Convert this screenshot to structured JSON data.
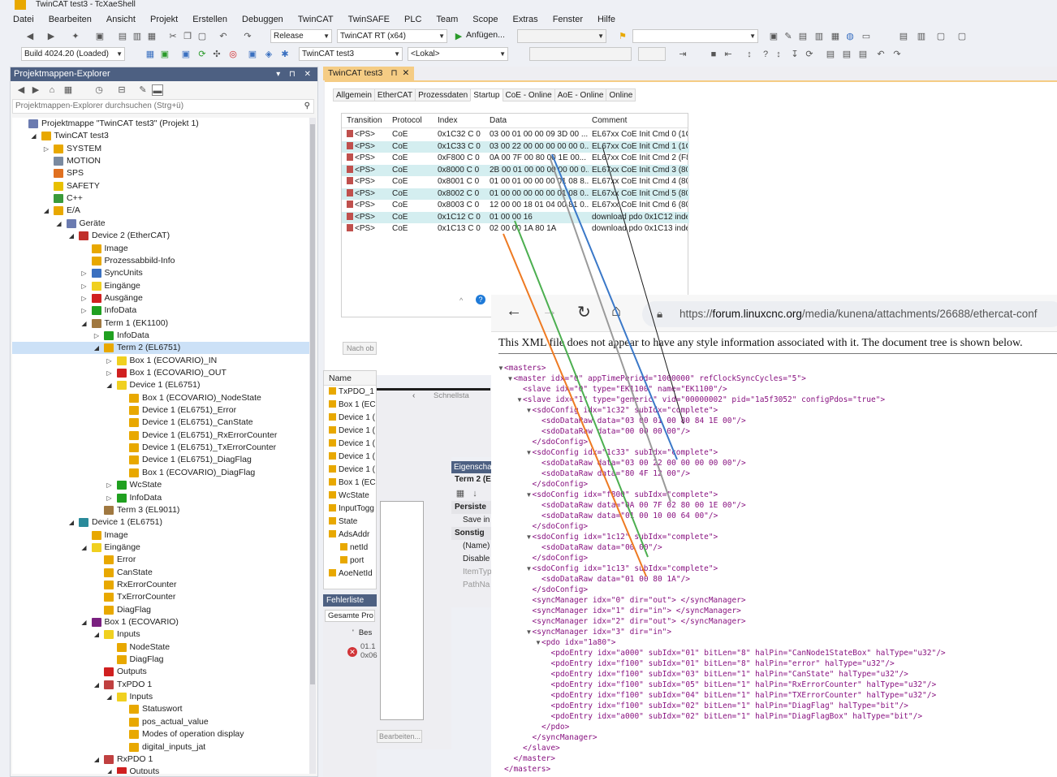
{
  "window": {
    "title": "TwinCAT test3 - TcXaeShell"
  },
  "menu": [
    "Datei",
    "Bearbeiten",
    "Ansicht",
    "Projekt",
    "Erstellen",
    "Debuggen",
    "TwinCAT",
    "TwinSAFE",
    "PLC",
    "Team",
    "Scope",
    "Extras",
    "Fenster",
    "Hilfe"
  ],
  "toolbar": {
    "config": "Release",
    "platform": "TwinCAT RT (x64)",
    "attach": "Anfügen...",
    "build": "Build 4024.20 (Loaded)",
    "project": "TwinCAT test3",
    "target": "<Lokal>"
  },
  "explorer": {
    "title": "Projektmappen-Explorer",
    "search_placeholder": "Projektmappen-Explorer durchsuchen (Strg+ü)",
    "items": [
      {
        "label": "Projektmappe \"TwinCAT test3\" (Projekt 1)",
        "lvl": 0,
        "exp": "",
        "color": "#6b7bb0"
      },
      {
        "label": "TwinCAT test3",
        "lvl": 1,
        "exp": "◢",
        "color": "#e8a800"
      },
      {
        "label": "SYSTEM",
        "lvl": 2,
        "exp": "▷",
        "color": "#e8a800"
      },
      {
        "label": "MOTION",
        "lvl": 2,
        "exp": "",
        "color": "#7a8aa0"
      },
      {
        "label": "SPS",
        "lvl": 2,
        "exp": "",
        "color": "#e07020"
      },
      {
        "label": "SAFETY",
        "lvl": 2,
        "exp": "",
        "color": "#e8c000"
      },
      {
        "label": "C++",
        "lvl": 2,
        "exp": "",
        "color": "#3a9a3a"
      },
      {
        "label": "E/A",
        "lvl": 2,
        "exp": "◢",
        "color": "#e8a800"
      },
      {
        "label": "Geräte",
        "lvl": 3,
        "exp": "◢",
        "color": "#6b7bb0"
      },
      {
        "label": "Device 2 (EtherCAT)",
        "lvl": 4,
        "exp": "◢",
        "color": "#c0302a"
      },
      {
        "label": "Image",
        "lvl": 5,
        "exp": "",
        "color": "#e8a800"
      },
      {
        "label": "Prozessabbild-Info",
        "lvl": 5,
        "exp": "",
        "color": "#e8a800"
      },
      {
        "label": "SyncUnits",
        "lvl": 5,
        "exp": "▷",
        "color": "#3a70c0"
      },
      {
        "label": "Eingänge",
        "lvl": 5,
        "exp": "▷",
        "color": "#f0d020"
      },
      {
        "label": "Ausgänge",
        "lvl": 5,
        "exp": "▷",
        "color": "#d02020"
      },
      {
        "label": "InfoData",
        "lvl": 5,
        "exp": "▷",
        "color": "#20a020"
      },
      {
        "label": "Term 1 (EK1100)",
        "lvl": 5,
        "exp": "◢",
        "color": "#a07840"
      },
      {
        "label": "InfoData",
        "lvl": 6,
        "exp": "▷",
        "color": "#20a020"
      },
      {
        "label": "Term 2 (EL6751)",
        "lvl": 6,
        "exp": "◢",
        "color": "#e8a800",
        "sel": true
      },
      {
        "label": "Box 1 (ECOVARIO)_IN",
        "lvl": 7,
        "exp": "▷",
        "color": "#f0d020"
      },
      {
        "label": "Box 1 (ECOVARIO)_OUT",
        "lvl": 7,
        "exp": "▷",
        "color": "#d02020"
      },
      {
        "label": "Device 1 (EL6751)",
        "lvl": 7,
        "exp": "◢",
        "color": "#f0d020"
      },
      {
        "label": "Box 1 (ECOVARIO)_NodeState",
        "lvl": 8,
        "exp": "",
        "color": "#e8a800"
      },
      {
        "label": "Device 1 (EL6751)_Error",
        "lvl": 8,
        "exp": "",
        "color": "#e8a800"
      },
      {
        "label": "Device 1 (EL6751)_CanState",
        "lvl": 8,
        "exp": "",
        "color": "#e8a800"
      },
      {
        "label": "Device 1 (EL6751)_RxErrorCounter",
        "lvl": 8,
        "exp": "",
        "color": "#e8a800"
      },
      {
        "label": "Device 1 (EL6751)_TxErrorCounter",
        "lvl": 8,
        "exp": "",
        "color": "#e8a800"
      },
      {
        "label": "Device 1 (EL6751)_DiagFlag",
        "lvl": 8,
        "exp": "",
        "color": "#e8a800"
      },
      {
        "label": "Box 1 (ECOVARIO)_DiagFlag",
        "lvl": 8,
        "exp": "",
        "color": "#e8a800"
      },
      {
        "label": "WcState",
        "lvl": 7,
        "exp": "▷",
        "color": "#20a020"
      },
      {
        "label": "InfoData",
        "lvl": 7,
        "exp": "▷",
        "color": "#20a020"
      },
      {
        "label": "Term 3 (EL9011)",
        "lvl": 6,
        "exp": "",
        "color": "#a07840"
      },
      {
        "label": "Device 1 (EL6751)",
        "lvl": 4,
        "exp": "◢",
        "color": "#2a8a9a"
      },
      {
        "label": "Image",
        "lvl": 5,
        "exp": "",
        "color": "#e8a800"
      },
      {
        "label": "Eingänge",
        "lvl": 5,
        "exp": "◢",
        "color": "#f0d020"
      },
      {
        "label": "Error",
        "lvl": 6,
        "exp": "",
        "color": "#e8a800"
      },
      {
        "label": "CanState",
        "lvl": 6,
        "exp": "",
        "color": "#e8a800"
      },
      {
        "label": "RxErrorCounter",
        "lvl": 6,
        "exp": "",
        "color": "#e8a800"
      },
      {
        "label": "TxErrorCounter",
        "lvl": 6,
        "exp": "",
        "color": "#e8a800"
      },
      {
        "label": "DiagFlag",
        "lvl": 6,
        "exp": "",
        "color": "#e8a800"
      },
      {
        "label": "Box 1 (ECOVARIO)",
        "lvl": 5,
        "exp": "◢",
        "color": "#7a2080"
      },
      {
        "label": "Inputs",
        "lvl": 6,
        "exp": "◢",
        "color": "#f0d020"
      },
      {
        "label": "NodeState",
        "lvl": 7,
        "exp": "",
        "color": "#e8a800"
      },
      {
        "label": "DiagFlag",
        "lvl": 7,
        "exp": "",
        "color": "#e8a800"
      },
      {
        "label": "Outputs",
        "lvl": 6,
        "exp": "",
        "color": "#d02020"
      },
      {
        "label": "TxPDO 1",
        "lvl": 6,
        "exp": "◢",
        "color": "#c04040"
      },
      {
        "label": "Inputs",
        "lvl": 7,
        "exp": "◢",
        "color": "#f0d020"
      },
      {
        "label": "Statuswort",
        "lvl": 8,
        "exp": "",
        "color": "#e8a800"
      },
      {
        "label": "pos_actual_value",
        "lvl": 8,
        "exp": "",
        "color": "#e8a800"
      },
      {
        "label": "Modes of operation display",
        "lvl": 8,
        "exp": "",
        "color": "#e8a800"
      },
      {
        "label": "digital_inputs_jat",
        "lvl": 8,
        "exp": "",
        "color": "#e8a800"
      },
      {
        "label": "RxPDO 1",
        "lvl": 6,
        "exp": "◢",
        "color": "#c04040"
      },
      {
        "label": "Outputs",
        "lvl": 7,
        "exp": "◢",
        "color": "#d02020"
      }
    ]
  },
  "editor": {
    "tab": "TwinCAT test3",
    "subtabs": [
      "Allgemein",
      "EtherCAT",
      "Prozessdaten",
      "Startup",
      "CoE - Online",
      "AoE - Online",
      "Online"
    ],
    "active_subtab": "Startup",
    "columns": [
      "Transition",
      "Protocol",
      "Index",
      "Data",
      "Comment"
    ],
    "rows": [
      {
        "transition": "<PS>",
        "protocol": "CoE",
        "index": "0x1C32 C 0",
        "data": "03 00 01 00 00 09 3D 00 ...",
        "comment": "EL67xx CoE Init Cmd 0 (1C..."
      },
      {
        "transition": "<PS>",
        "protocol": "CoE",
        "index": "0x1C33 C 0",
        "data": "03 00 22 00 00 00 00 00 0...",
        "comment": "EL67xx CoE Init Cmd 1 (1C..."
      },
      {
        "transition": "<PS>",
        "protocol": "CoE",
        "index": "0xF800 C 0",
        "data": "0A 00 7F 00 80 00 1E 00...",
        "comment": "EL67xx CoE Init Cmd 2 (F8..."
      },
      {
        "transition": "<PS>",
        "protocol": "CoE",
        "index": "0x8000 C 0",
        "data": "2B 00 01 00 00 00 00 00 0...",
        "comment": "EL67xx CoE Init Cmd 3 (80..."
      },
      {
        "transition": "<PS>",
        "protocol": "CoE",
        "index": "0x8001 C 0",
        "data": "01 00 01 00 00 00 01 08 8...",
        "comment": "EL67xx CoE Init Cmd 4 (80..."
      },
      {
        "transition": "<PS>",
        "protocol": "CoE",
        "index": "0x8002 C 0",
        "data": "01 00 00 00 00 00 01 08 0...",
        "comment": "EL67xx CoE Init Cmd 5 (80..."
      },
      {
        "transition": "<PS>",
        "protocol": "CoE",
        "index": "0x8003 C 0",
        "data": "12 00 00 18 01 04 00 81 0...",
        "comment": "EL67xx CoE Init Cmd 6 (80..."
      },
      {
        "transition": "<PS>",
        "protocol": "CoE",
        "index": "0x1C12 C 0",
        "data": "01 00 00 16",
        "comment": "download pdo 0x1C12 index"
      },
      {
        "transition": "<PS>",
        "protocol": "CoE",
        "index": "0x1C13 C 0",
        "data": "02 00 00 1A 80 1A",
        "comment": "download pdo 0x1C13 index"
      }
    ],
    "button_nach": "Nach ob"
  },
  "name_panel": {
    "header": "Name",
    "items": [
      "TxPDO_1",
      "Box 1 (EC",
      "Device 1 (",
      "Device 1 (",
      "Device 1 (",
      "Device 1 (",
      "Device 1 (",
      "Box 1 (EC",
      "WcState",
      "InputTogg",
      "State",
      "AdsAddr",
      "netId",
      "port",
      "AoeNetId"
    ]
  },
  "quicksearch": "Schnellsta",
  "properties": {
    "title": "Eigenscha",
    "object": "Term 2 (E",
    "categories": [
      "Persiste",
      "Save in",
      "Sonstig",
      "(Name)",
      "Disable",
      "ItemTyp",
      "PathNa"
    ],
    "button": "Bearbeiten..."
  },
  "errorlist": {
    "title": "Fehlerliste",
    "scope": "Gesamte Pro",
    "col": "Bes",
    "entry_line1": "01.1",
    "entry_line2": "0x06"
  },
  "browser": {
    "url_domain": "forum.linuxcnc.org",
    "url_path": "/media/kunena/attachments/26688/ethercat-conf",
    "url_prefix": "https://",
    "note": "This XML file does not appear to have any style information associated with it. The document tree is shown below.",
    "xml_lines": [
      {
        "i": 0,
        "tri": true,
        "t": "<masters>"
      },
      {
        "i": 1,
        "tri": true,
        "t": "<master idx=\"0\" appTimePeriod=\"1000000\" refClockSyncCycles=\"5\">"
      },
      {
        "i": 2,
        "tri": false,
        "t": "<slave idx=\"0\" type=\"EK1100\" name=\"EK1100\"/>"
      },
      {
        "i": 2,
        "tri": true,
        "t": "<slave idx=\"1\" type=\"generic\" vid=\"00000002\" pid=\"1a5f3052\" configPdos=\"true\">"
      },
      {
        "i": 3,
        "tri": true,
        "t": "<sdoConfig idx=\"1c32\" subIdx=\"complete\">"
      },
      {
        "i": 4,
        "tri": false,
        "t": "<sdoDataRaw data=\"03 00 01 00 80 84 1E 00\"/>"
      },
      {
        "i": 4,
        "tri": false,
        "t": "<sdoDataRaw data=\"00 00 00 00\"/>"
      },
      {
        "i": 3,
        "tri": false,
        "t": "</sdoConfig>"
      },
      {
        "i": 3,
        "tri": true,
        "t": "<sdoConfig idx=\"1c33\" subIdx=\"complete\">"
      },
      {
        "i": 4,
        "tri": false,
        "t": "<sdoDataRaw data=\"03 00 22 00 00 00 00 00\"/>"
      },
      {
        "i": 4,
        "tri": false,
        "t": "<sdoDataRaw data=\"80 4F 12 00\"/>"
      },
      {
        "i": 3,
        "tri": false,
        "t": "</sdoConfig>"
      },
      {
        "i": 3,
        "tri": true,
        "t": "<sdoConfig idx=\"f800\" subIdx=\"complete\">"
      },
      {
        "i": 4,
        "tri": false,
        "t": "<sdoDataRaw data=\"0A 00 7F 02 80 00 1E 00\"/>"
      },
      {
        "i": 4,
        "tri": false,
        "t": "<sdoDataRaw data=\"01 00 10 00 64 00\"/>"
      },
      {
        "i": 3,
        "tri": false,
        "t": "</sdoConfig>"
      },
      {
        "i": 3,
        "tri": true,
        "t": "<sdoConfig idx=\"1c12\" subIdx=\"complete\">"
      },
      {
        "i": 4,
        "tri": false,
        "t": "<sdoDataRaw data=\"00 00\"/>"
      },
      {
        "i": 3,
        "tri": false,
        "t": "</sdoConfig>"
      },
      {
        "i": 3,
        "tri": true,
        "t": "<sdoConfig idx=\"1c13\" subIdx=\"complete\">"
      },
      {
        "i": 4,
        "tri": false,
        "t": "<sdoDataRaw data=\"01 00 80 1A\"/>"
      },
      {
        "i": 3,
        "tri": false,
        "t": "</sdoConfig>"
      },
      {
        "i": 3,
        "tri": false,
        "t": "<syncManager idx=\"0\" dir=\"out\"> </syncManager>"
      },
      {
        "i": 3,
        "tri": false,
        "t": "<syncManager idx=\"1\" dir=\"in\"> </syncManager>"
      },
      {
        "i": 3,
        "tri": false,
        "t": "<syncManager idx=\"2\" dir=\"out\"> </syncManager>"
      },
      {
        "i": 3,
        "tri": true,
        "t": "<syncManager idx=\"3\" dir=\"in\">"
      },
      {
        "i": 4,
        "tri": true,
        "t": "<pdo idx=\"1a80\">"
      },
      {
        "i": 5,
        "tri": false,
        "t": "<pdoEntry idx=\"a000\" subIdx=\"01\" bitLen=\"8\" halPin=\"CanNode1StateBox\" halType=\"u32\"/>"
      },
      {
        "i": 5,
        "tri": false,
        "t": "<pdoEntry idx=\"f100\" subIdx=\"01\" bitLen=\"8\" halPin=\"error\" halType=\"u32\"/>"
      },
      {
        "i": 5,
        "tri": false,
        "t": "<pdoEntry idx=\"f100\" subIdx=\"03\" bitLen=\"1\" halPin=\"CanState\" halType=\"u32\"/>"
      },
      {
        "i": 5,
        "tri": false,
        "t": "<pdoEntry idx=\"f100\" subIdx=\"05\" bitLen=\"1\" halPin=\"RxErrorCounter\" halType=\"u32\"/>"
      },
      {
        "i": 5,
        "tri": false,
        "t": "<pdoEntry idx=\"f100\" subIdx=\"04\" bitLen=\"1\" halPin=\"TXErrorCounter\" halType=\"u32\"/>"
      },
      {
        "i": 5,
        "tri": false,
        "t": "<pdoEntry idx=\"f100\" subIdx=\"02\" bitLen=\"1\" halPin=\"DiagFlag\" halType=\"bit\"/>"
      },
      {
        "i": 5,
        "tri": false,
        "t": "<pdoEntry idx=\"a000\" subIdx=\"02\" bitLen=\"1\" halPin=\"DiagFlagBox\" halType=\"bit\"/>"
      },
      {
        "i": 4,
        "tri": false,
        "t": "</pdo>"
      },
      {
        "i": 3,
        "tri": false,
        "t": "</syncManager>"
      },
      {
        "i": 2,
        "tri": false,
        "t": "</slave>"
      },
      {
        "i": 1,
        "tri": false,
        "t": "</master>"
      },
      {
        "i": 0,
        "tri": false,
        "t": "</masters>"
      }
    ]
  },
  "annotation_colors": [
    "#1a1a1a",
    "#3a78c8",
    "#9a9a9a",
    "#4caf50",
    "#ee7a22"
  ]
}
